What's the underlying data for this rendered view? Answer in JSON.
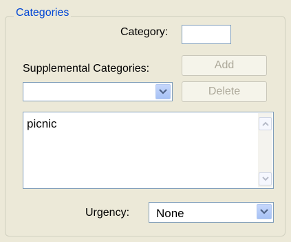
{
  "categories_group": {
    "title": "Categories",
    "category_label": "Category:",
    "category_value": "",
    "supplemental_label": "Supplemental Categories:",
    "add_button": "Add",
    "delete_button": "Delete",
    "supplemental_combo_value": "",
    "supplemental_list": [
      "picnic"
    ],
    "urgency_label": "Urgency:",
    "urgency_value": "None"
  },
  "icons": {
    "dropdown": "chevron-down-icon",
    "scroll_up": "scroll-up-arrow-icon",
    "scroll_down": "scroll-down-arrow-icon"
  },
  "colors": {
    "group_title": "#0046d5",
    "disabled_text": "#aca899",
    "field_border": "#7f9db9",
    "window_bg": "#ece9d8"
  }
}
